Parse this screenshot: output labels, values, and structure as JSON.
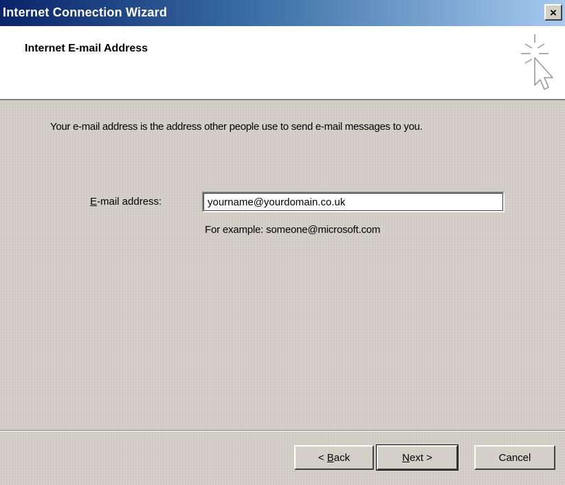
{
  "window": {
    "title": "Internet Connection Wizard",
    "close_glyph": "×"
  },
  "header": {
    "title": "Internet E-mail Address",
    "icon": "wizard-cursor-icon"
  },
  "body": {
    "intro_text": "Your e-mail address is the address other people use to send e-mail messages to you.",
    "field_label_mnemonic": "E",
    "field_label_rest": "-mail address:",
    "email_value": "yourname@yourdomain.co.uk",
    "example_text": "For example: someone@microsoft.com"
  },
  "buttons": {
    "back_prefix": "< ",
    "back_mnemonic": "B",
    "back_rest": "ack",
    "next_mnemonic": "N",
    "next_rest": "ext >",
    "cancel_label": "Cancel"
  },
  "colors": {
    "titlebar_start": "#0a246a",
    "titlebar_end": "#a6caf0",
    "face": "#d4d0c8"
  }
}
